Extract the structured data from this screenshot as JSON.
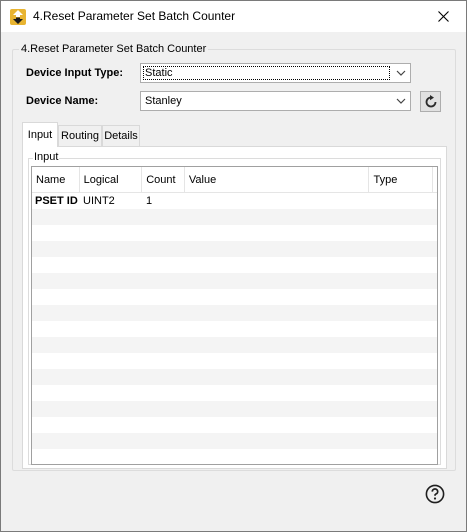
{
  "window": {
    "title": "4.Reset Parameter Set Batch Counter",
    "icon": "app-arrow-up-down-icon",
    "accent": "#e8b431"
  },
  "group": {
    "title": "4.Reset Parameter Set Batch Counter"
  },
  "device_input_type": {
    "label": "Device Input Type:",
    "value": "Static"
  },
  "device_name": {
    "label": "Device Name:",
    "value": "Stanley"
  },
  "tabs": [
    {
      "label": "Input",
      "active": true
    },
    {
      "label": "Routing",
      "active": false
    },
    {
      "label": "Details",
      "active": false
    }
  ],
  "input_group": {
    "title": "Input"
  },
  "table": {
    "columns": [
      "Name",
      "Logical",
      "Count",
      "Value",
      "Type"
    ],
    "rows": [
      {
        "name": "PSET ID",
        "logical": "UINT2",
        "count": "1",
        "value": "",
        "type": ""
      }
    ]
  },
  "icons": {
    "refresh": "refresh-icon",
    "help": "help-icon",
    "close": "close-icon",
    "dropdown": "chevron-down-icon"
  }
}
